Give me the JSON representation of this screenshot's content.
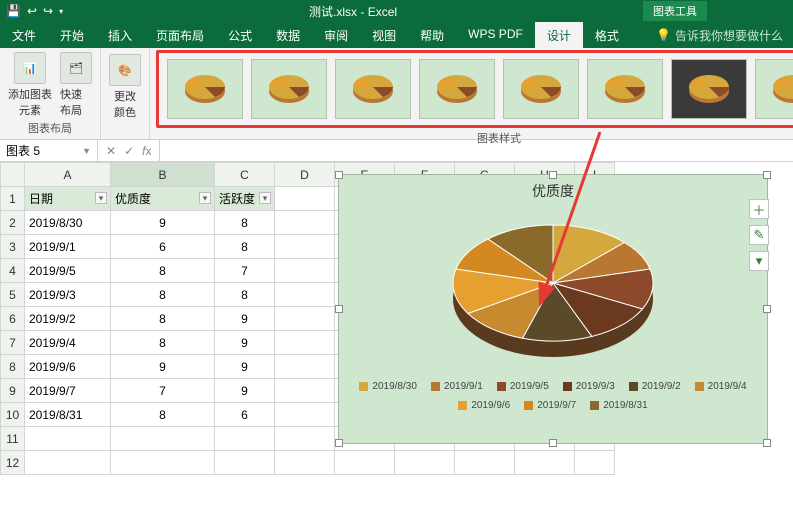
{
  "titlebar": {
    "title": "测试.xlsx - Excel",
    "context_tab": "图表工具"
  },
  "menu": {
    "file": "文件",
    "tabs": [
      "开始",
      "插入",
      "页面布局",
      "公式",
      "数据",
      "审阅",
      "视图",
      "帮助",
      "WPS PDF",
      "设计",
      "格式"
    ],
    "active": "设计",
    "tell_me": "告诉我你想要做什么"
  },
  "ribbon": {
    "group_layout": {
      "label": "图表布局",
      "add_element": "添加图表\n元素",
      "quick_layout": "快速布局"
    },
    "group_colors": {
      "label": "",
      "change_colors": "更改\n颜色"
    },
    "group_styles": {
      "label": "图表样式"
    }
  },
  "namebox": "图表 5",
  "columns": [
    "A",
    "B",
    "C",
    "D",
    "E",
    "F",
    "G",
    "H",
    "I"
  ],
  "col_headers": {
    "A": "日期",
    "B": "优质度",
    "C": "活跃度"
  },
  "rows": [
    {
      "r": 1
    },
    {
      "r": 2,
      "A": "2019/8/30",
      "B": "9",
      "C": "8"
    },
    {
      "r": 3,
      "A": "2019/9/1",
      "B": "6",
      "C": "8"
    },
    {
      "r": 4,
      "A": "2019/9/5",
      "B": "8",
      "C": "7"
    },
    {
      "r": 5,
      "A": "2019/9/3",
      "B": "8",
      "C": "8"
    },
    {
      "r": 6,
      "A": "2019/9/2",
      "B": "8",
      "C": "9"
    },
    {
      "r": 7,
      "A": "2019/9/4",
      "B": "8",
      "C": "9"
    },
    {
      "r": 8,
      "A": "2019/9/6",
      "B": "9",
      "C": "9"
    },
    {
      "r": 9,
      "A": "2019/9/7",
      "B": "7",
      "C": "9"
    },
    {
      "r": 10,
      "A": "2019/8/31",
      "B": "8",
      "C": "6"
    },
    {
      "r": 11
    },
    {
      "r": 12
    }
  ],
  "chart": {
    "title": "优质度",
    "legend": [
      "2019/8/30",
      "2019/9/1",
      "2019/9/5",
      "2019/9/3",
      "2019/9/2",
      "2019/9/4",
      "2019/9/6",
      "2019/9/7",
      "2019/8/31"
    ],
    "colors": [
      "#d4a83c",
      "#b87832",
      "#8c4a2a",
      "#6b3a1e",
      "#5a4a2a",
      "#c88a2e",
      "#e6a030",
      "#d48820",
      "#8a6a2a"
    ]
  },
  "chart_data": {
    "type": "pie",
    "title": "优质度",
    "categories": [
      "2019/8/30",
      "2019/9/1",
      "2019/9/5",
      "2019/9/3",
      "2019/9/2",
      "2019/9/4",
      "2019/9/6",
      "2019/9/7",
      "2019/8/31"
    ],
    "values": [
      9,
      6,
      8,
      8,
      8,
      8,
      9,
      7,
      8
    ],
    "variant": "3D",
    "legend_position": "bottom"
  }
}
